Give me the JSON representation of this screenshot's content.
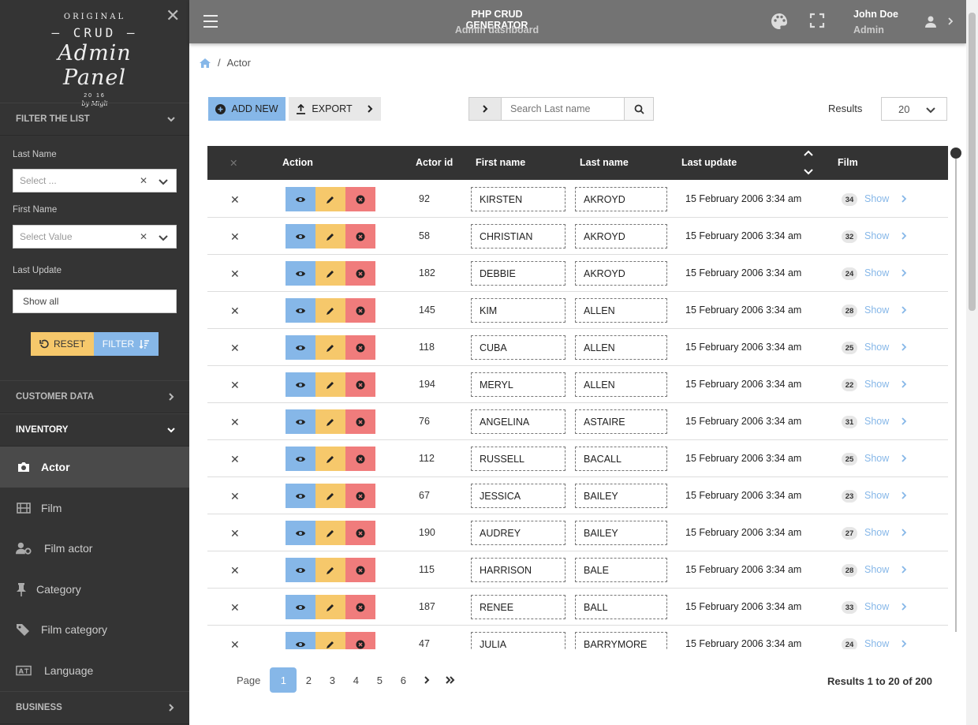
{
  "app": {
    "title": "PHP CRUD GENERATOR",
    "subtitle": "Admin dashboard",
    "user_name": "John Doe",
    "user_role": "Admin"
  },
  "logo": {
    "line1": "ORIGINAL",
    "line2": "— CRUD —",
    "line3": "Admin Panel",
    "line4": "20          16",
    "line5": "by Migli"
  },
  "sidebar": {
    "filter_title": "FILTER THE LIST",
    "filters": {
      "last_name_label": "Last Name",
      "last_name_placeholder": "Select ...",
      "first_name_label": "First Name",
      "first_name_placeholder": "Select Value",
      "last_update_label": "Last Update",
      "last_update_value": "Show all",
      "reset_label": "RESET",
      "filter_label": "FILTER"
    },
    "sections": {
      "customer": "CUSTOMER DATA",
      "inventory": "INVENTORY",
      "business": "BUSINESS"
    },
    "items": [
      {
        "label": "Actor",
        "icon": "camera-icon"
      },
      {
        "label": "Film",
        "icon": "film-icon"
      },
      {
        "label": "Film actor",
        "icon": "user-gear-icon"
      },
      {
        "label": "Category",
        "icon": "pin-icon"
      },
      {
        "label": "Film category",
        "icon": "tags-icon"
      },
      {
        "label": "Language",
        "icon": "language-icon"
      }
    ]
  },
  "breadcrumb": {
    "current": "Actor"
  },
  "toolbar": {
    "add_label": "ADD NEW",
    "export_label": "EXPORT",
    "search_placeholder": "Search Last name",
    "results_label": "Results",
    "results_value": "20"
  },
  "table": {
    "headers": {
      "action": "Action",
      "actor_id": "Actor id",
      "first_name": "First name",
      "last_name": "Last name",
      "last_update": "Last update",
      "film": "Film"
    },
    "show_label": "Show",
    "rows": [
      {
        "id": "92",
        "first": "KIRSTEN",
        "last": "AKROYD",
        "updated": "15 February 2006 3:34 am",
        "films": "34"
      },
      {
        "id": "58",
        "first": "CHRISTIAN",
        "last": "AKROYD",
        "updated": "15 February 2006 3:34 am",
        "films": "32"
      },
      {
        "id": "182",
        "first": "DEBBIE",
        "last": "AKROYD",
        "updated": "15 February 2006 3:34 am",
        "films": "24"
      },
      {
        "id": "145",
        "first": "KIM",
        "last": "ALLEN",
        "updated": "15 February 2006 3:34 am",
        "films": "28"
      },
      {
        "id": "118",
        "first": "CUBA",
        "last": "ALLEN",
        "updated": "15 February 2006 3:34 am",
        "films": "25"
      },
      {
        "id": "194",
        "first": "MERYL",
        "last": "ALLEN",
        "updated": "15 February 2006 3:34 am",
        "films": "22"
      },
      {
        "id": "76",
        "first": "ANGELINA",
        "last": "ASTAIRE",
        "updated": "15 February 2006 3:34 am",
        "films": "31"
      },
      {
        "id": "112",
        "first": "RUSSELL",
        "last": "BACALL",
        "updated": "15 February 2006 3:34 am",
        "films": "25"
      },
      {
        "id": "67",
        "first": "JESSICA",
        "last": "BAILEY",
        "updated": "15 February 2006 3:34 am",
        "films": "23"
      },
      {
        "id": "190",
        "first": "AUDREY",
        "last": "BAILEY",
        "updated": "15 February 2006 3:34 am",
        "films": "27"
      },
      {
        "id": "115",
        "first": "HARRISON",
        "last": "BALE",
        "updated": "15 February 2006 3:34 am",
        "films": "28"
      },
      {
        "id": "187",
        "first": "RENEE",
        "last": "BALL",
        "updated": "15 February 2006 3:34 am",
        "films": "33"
      },
      {
        "id": "47",
        "first": "JULIA",
        "last": "BARRYMORE",
        "updated": "15 February 2006 3:34 am",
        "films": "24"
      }
    ]
  },
  "pagination": {
    "label": "Page",
    "pages": [
      "1",
      "2",
      "3",
      "4",
      "5",
      "6"
    ],
    "current": "1",
    "info": "Results 1 to 20 of 200"
  },
  "colors": {
    "sidebar_bg": "#343434",
    "topbar_bg": "#737373",
    "primary": "#86b7e8",
    "warning": "#f6c86b",
    "danger": "#f07c7c",
    "table_head": "#333333"
  }
}
